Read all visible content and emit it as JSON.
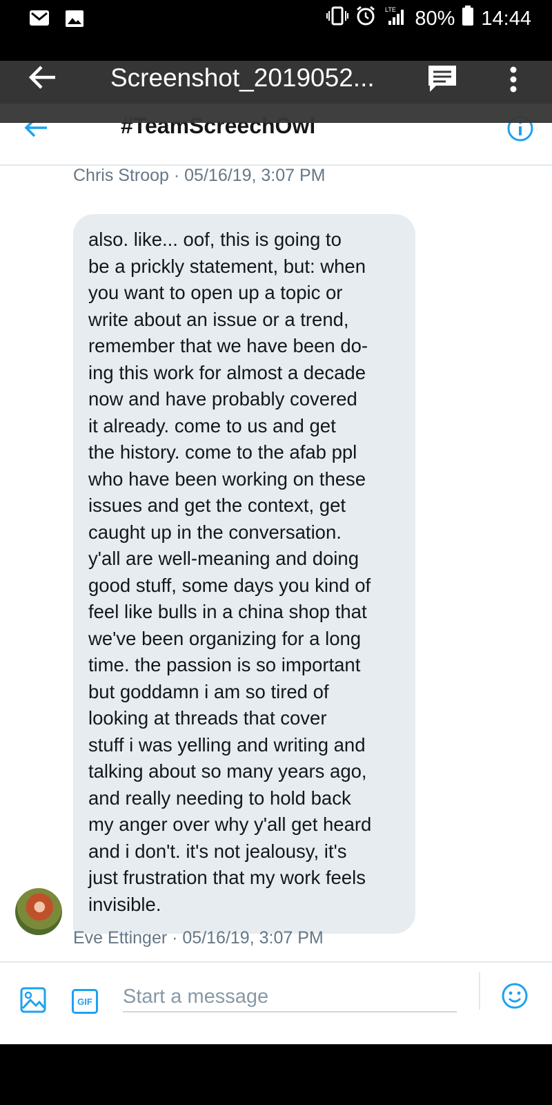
{
  "status_bar": {
    "battery": "80%",
    "time": "14:44",
    "network": "LTE"
  },
  "viewer": {
    "title": "Screenshot_2019052..."
  },
  "conversation": {
    "title": "#TeamScreechOwl",
    "previous_meta": "Chris Stroop · 05/16/19, 3:07 PM",
    "message": {
      "text": "also. like... oof, this is going to\nbe a prickly statement, but: when\nyou want to open up a topic or\nwrite about an issue or a trend,\nremember that we have been do-\ning this work for almost a decade\nnow and have probably covered\nit already.  come to us and get\nthe history. come to the afab ppl\nwho have been working on these\nissues and get the context, get\ncaught up in the conversation.\ny'all are well-meaning and doing\ngood stuff, some days you kind of\nfeel like bulls in a china shop that\nwe've been organizing for a long\ntime. the passion is so important\nbut goddamn i am so tired of\nlooking at threads that cover\nstuff i was yelling and writing and\ntalking about so many years ago,\nand really needing to hold back\nmy anger over why y'all get heard\nand i don't. it's not jealousy, it's\njust frustration that my work feels\ninvisible.",
      "meta": "Eve Ettinger · 05/16/19, 3:07 PM"
    }
  },
  "composer": {
    "placeholder": "Start a message",
    "gif_label": "GIF"
  },
  "colors": {
    "accent": "#1da1f2",
    "bubble": "#e6ecf0",
    "meta_text": "#657786"
  }
}
